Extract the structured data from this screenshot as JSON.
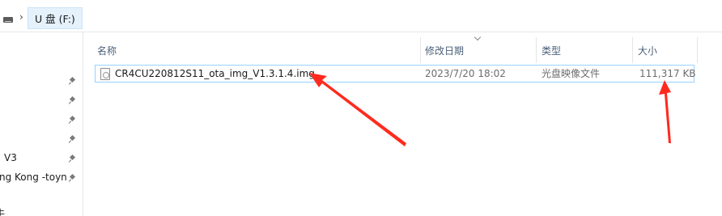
{
  "address_bar": {
    "crumb_separator": "›",
    "location": "U 盘 (F:)"
  },
  "nav_pane": {
    "items": [
      {
        "label": "",
        "pinned": true
      },
      {
        "label": "",
        "pinned": true
      },
      {
        "label": "",
        "pinned": true
      },
      {
        "label": "",
        "pinned": true
      },
      {
        "label": "V3",
        "pinned": true
      },
      {
        "label": "ng Kong -toyn",
        "pinned": true
      },
      {
        "label": "",
        "pinned": false
      },
      {
        "label": "牛",
        "pinned": false
      }
    ]
  },
  "columns": {
    "name": "名称",
    "date_modified": "修改日期",
    "type": "类型",
    "size": "大小"
  },
  "files": [
    {
      "name": "CR4CU220812S11_ota_img_V1.3.1.4.img",
      "date_modified": "2023/7/20 18:02",
      "type": "光盘映像文件",
      "size": "111,317 KB",
      "icon": "disc-image-file-icon"
    }
  ],
  "annotations": {
    "arrow_color": "#ff2a1f"
  }
}
